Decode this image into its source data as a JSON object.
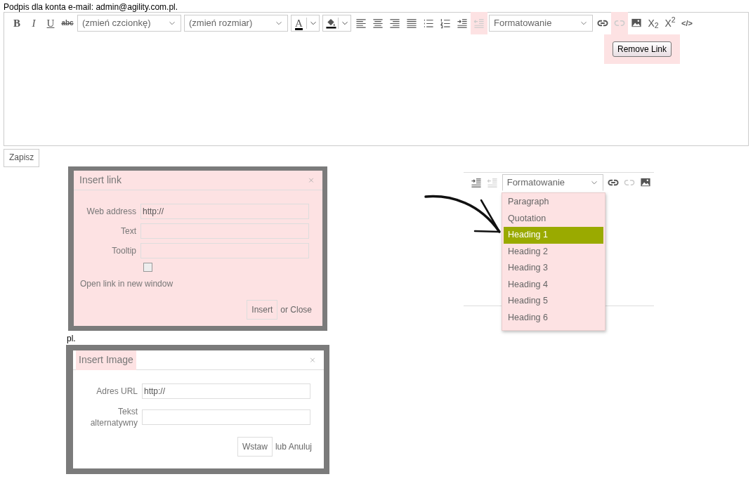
{
  "signature_label": "Podpis dla konta e-mail: admin@agility.com.pl.",
  "toolbar": [
    {
      "kind": "bold",
      "label": "B",
      "disabled": false,
      "highlighted": false
    },
    {
      "kind": "italic",
      "label": "I",
      "disabled": false,
      "highlighted": false
    },
    {
      "kind": "underline",
      "label": "U",
      "disabled": false,
      "highlighted": false
    },
    {
      "kind": "strike",
      "label": "abc",
      "disabled": false,
      "highlighted": false
    },
    {
      "kind": "select",
      "value": "(zmień czcionkę)",
      "disabled": false,
      "highlighted": false
    },
    {
      "kind": "select",
      "value": "(zmień rozmiar)",
      "disabled": false,
      "highlighted": false
    },
    {
      "kind": "fontcolor",
      "label": "A",
      "disabled": false,
      "highlighted": false
    },
    {
      "kind": "fillcolor",
      "disabled": false,
      "highlighted": false
    },
    {
      "kind": "alignleft",
      "disabled": false,
      "highlighted": false
    },
    {
      "kind": "aligncenter",
      "disabled": false,
      "highlighted": false
    },
    {
      "kind": "alignright",
      "disabled": false,
      "highlighted": false
    },
    {
      "kind": "justify",
      "disabled": false,
      "highlighted": false
    },
    {
      "kind": "bullets",
      "disabled": false,
      "highlighted": false
    },
    {
      "kind": "numbers",
      "disabled": false,
      "highlighted": false
    },
    {
      "kind": "indent",
      "disabled": false,
      "highlighted": false
    },
    {
      "kind": "outdent",
      "disabled": true,
      "highlighted": true
    },
    {
      "kind": "select",
      "value": "Formatowanie",
      "disabled": false,
      "highlighted": false
    },
    {
      "kind": "link",
      "disabled": false,
      "highlighted": false
    },
    {
      "kind": "unlink",
      "disabled": true,
      "highlighted": true
    },
    {
      "kind": "image",
      "disabled": false,
      "highlighted": false
    },
    {
      "kind": "subscript",
      "label": "X$_{2}$",
      "disabled": false,
      "highlighted": false
    },
    {
      "kind": "superscript",
      "label": "X$^{2}$",
      "disabled": false,
      "highlighted": false
    },
    {
      "kind": "code",
      "label": "</>",
      "disabled": false,
      "highlighted": false
    }
  ],
  "tooltip": {
    "text": "Remove Link",
    "highlighted": true
  },
  "save_button": "Zapisz",
  "link_dialog": {
    "title": "Insert link",
    "highlighted": true,
    "fields": [
      {
        "label": "Web address",
        "value": "http://"
      },
      {
        "label": "Text"
      },
      {
        "label": "Tooltip"
      }
    ],
    "checkbox": {
      "label": "Open link in new window",
      "checked": false
    },
    "button": "Insert",
    "close_text": "or Close"
  },
  "behind_text": "pl.",
  "image_dialog": {
    "title": "Insert Image",
    "title_highlighted": true,
    "fields": [
      {
        "label": "Adres URL",
        "value": "http://"
      },
      {
        "label": "Tekst alternatywny"
      }
    ],
    "button": "Wstaw",
    "close_text": "lub Anuluj"
  },
  "format_demo": {
    "toolbar": [
      {
        "kind": "indent",
        "disabled": false
      },
      {
        "kind": "outdent",
        "disabled": true
      },
      {
        "kind": "select",
        "value": "Formatowanie",
        "expanded": true
      },
      {
        "kind": "link",
        "disabled": false
      },
      {
        "kind": "unlink",
        "disabled": true
      },
      {
        "kind": "image",
        "disabled": false
      }
    ],
    "list_highlighted": true,
    "options": [
      {
        "label": "Paragraph",
        "selected": false
      },
      {
        "label": "Quotation",
        "selected": false
      },
      {
        "label": "Heading 1",
        "selected": true
      },
      {
        "label": "Heading 2",
        "selected": false
      },
      {
        "label": "Heading 3",
        "selected": false
      },
      {
        "label": "Heading 4",
        "selected": false
      },
      {
        "label": "Heading 5",
        "selected": false
      },
      {
        "label": "Heading 6",
        "selected": false
      }
    ]
  }
}
